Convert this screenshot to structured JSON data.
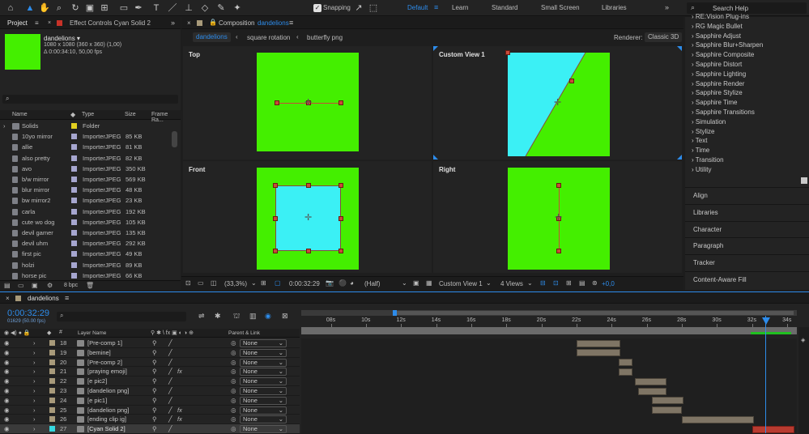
{
  "toolbar": {
    "snapping_label": "Snapping",
    "workspaces": [
      "Default",
      "Learn",
      "Standard",
      "Small Screen",
      "Libraries"
    ],
    "search_help": "Search Help"
  },
  "project": {
    "tab_project": "Project",
    "tab_effect_controls": "Effect Controls Cyan Solid 2",
    "comp_name": "dandelions ▾",
    "comp_size": "1080 x 1080  (360 x 360) (1,00)",
    "comp_duration": "Δ 0:00:34:10, 50,00 fps",
    "search_placeholder": "",
    "col_name": "Name",
    "col_type": "Type",
    "col_size": "Size",
    "col_frame": "Frame Ra...",
    "items": [
      {
        "name": "Solids",
        "type": "Folder",
        "size": "",
        "folder": true
      },
      {
        "name": "10yo mirror",
        "type": "ImporterJPEG",
        "size": "85 KB"
      },
      {
        "name": "allie",
        "type": "ImporterJPEG",
        "size": "81 KB"
      },
      {
        "name": "also pretty",
        "type": "ImporterJPEG",
        "size": "82 KB"
      },
      {
        "name": "avo",
        "type": "ImporterJPEG",
        "size": "350 KB"
      },
      {
        "name": "b/w mirror",
        "type": "ImporterJPEG",
        "size": "569 KB"
      },
      {
        "name": "blur mirror",
        "type": "ImporterJPEG",
        "size": "48 KB"
      },
      {
        "name": "bw mirror2",
        "type": "ImporterJPEG",
        "size": "23 KB"
      },
      {
        "name": "carla",
        "type": "ImporterJPEG",
        "size": "192 KB"
      },
      {
        "name": "cute wo dog",
        "type": "ImporterJPEG",
        "size": "105 KB"
      },
      {
        "name": "devil gamer",
        "type": "ImporterJPEG",
        "size": "135 KB"
      },
      {
        "name": "devil uhm",
        "type": "ImporterJPEG",
        "size": "292 KB"
      },
      {
        "name": "first pic",
        "type": "ImporterJPEG",
        "size": "49 KB"
      },
      {
        "name": "holzi",
        "type": "ImporterJPEG",
        "size": "89 KB"
      },
      {
        "name": "horse pic",
        "type": "ImporterJPEG",
        "size": "66 KB"
      }
    ],
    "bpc": "8 bpc"
  },
  "composition": {
    "tab_title": "Composition",
    "tab_comp_name": "dandelions",
    "breadcrumbs": [
      "dandelions",
      "square rotation",
      "butterfly png"
    ],
    "renderer_label": "Renderer:",
    "renderer_value": "Classic 3D",
    "views": [
      "Top",
      "Custom View 1",
      "Front",
      "Right"
    ],
    "footer": {
      "zoom": "(33,3%)",
      "timecode": "0:00:32:29",
      "resolution": "(Half)",
      "view": "Custom View 1",
      "layout": "4 Views",
      "exposure": "+0,0"
    }
  },
  "effects": {
    "items": [
      "RE:Vision Plug-ins",
      "RG Magic Bullet",
      "Sapphire Adjust",
      "Sapphire Blur+Sharpen",
      "Sapphire Composite",
      "Sapphire Distort",
      "Sapphire Lighting",
      "Sapphire Render",
      "Sapphire Stylize",
      "Sapphire Time",
      "Sapphire Transitions",
      "Simulation",
      "Stylize",
      "Text",
      "Time",
      "Transition",
      "Utility"
    ],
    "panels": [
      "Align",
      "Libraries",
      "Character",
      "Paragraph",
      "Tracker",
      "Content-Aware Fill"
    ]
  },
  "timeline": {
    "tab_name": "dandelions",
    "timecode": "0:00:32:29",
    "frame_info": "01629 (50.00 fps)",
    "col_layer_name": "Layer Name",
    "col_parent": "Parent & Link",
    "ruler": [
      "08s",
      "10s",
      "12s",
      "14s",
      "16s",
      "18s",
      "20s",
      "22s",
      "24s",
      "26s",
      "28s",
      "30s",
      "32s",
      "34s"
    ],
    "layers": [
      {
        "num": "18",
        "name": "[Pre-comp 1]",
        "color": "#a89a7a",
        "parent": "None",
        "fx": false,
        "bar_start": 22.0,
        "bar_end": 24.5
      },
      {
        "num": "19",
        "name": "[bemine]",
        "color": "#a89a7a",
        "parent": "None",
        "fx": false,
        "bar_start": 22.0,
        "bar_end": 24.5
      },
      {
        "num": "20",
        "name": "[Pre-comp 2]",
        "color": "#a89a7a",
        "parent": "None",
        "fx": false,
        "bar_start": 24.4,
        "bar_end": 25.2
      },
      {
        "num": "21",
        "name": "[praying emoji]",
        "color": "#a89a7a",
        "parent": "None",
        "fx": true,
        "bar_start": 24.4,
        "bar_end": 25.2
      },
      {
        "num": "22",
        "name": "[e pic2]",
        "color": "#a89a7a",
        "parent": "None",
        "fx": false,
        "bar_start": 25.3,
        "bar_end": 27.1
      },
      {
        "num": "23",
        "name": "[dandelion png]",
        "color": "#a89a7a",
        "parent": "None",
        "fx": false,
        "bar_start": 25.5,
        "bar_end": 27.1
      },
      {
        "num": "24",
        "name": "[e pic1]",
        "color": "#a89a7a",
        "parent": "None",
        "fx": false,
        "bar_start": 26.3,
        "bar_end": 28.1
      },
      {
        "num": "25",
        "name": "[dandelion png]",
        "color": "#a89a7a",
        "parent": "None",
        "fx": true,
        "bar_start": 26.3,
        "bar_end": 28.0
      },
      {
        "num": "26",
        "name": "[ending clip ig]",
        "color": "#a89a7a",
        "parent": "None",
        "fx": true,
        "bar_start": 28.0,
        "bar_end": 32.1
      },
      {
        "num": "27",
        "name": "[Cyan Solid 2]",
        "color": "#36d8e0",
        "parent": "None",
        "fx": false,
        "bar_start": 32.0,
        "bar_end": 34.4
      }
    ]
  }
}
